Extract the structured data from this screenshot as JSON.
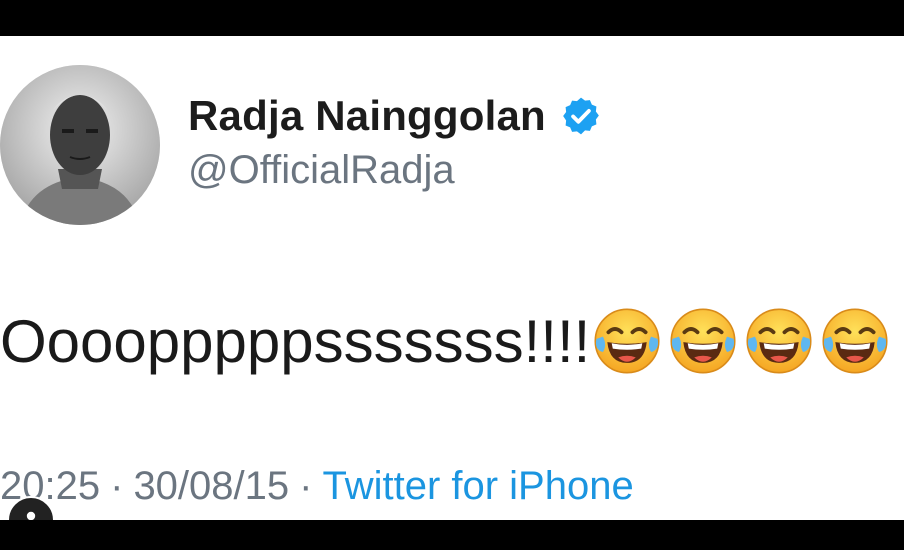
{
  "tweet": {
    "display_name": "Radja Nainggolan",
    "handle": "@OfficialRadja",
    "text": "Oooopppppsssssss!!!!",
    "emoji_count": 4,
    "emoji_icon": "face-with-tears-of-joy-icon",
    "time": "20:25",
    "date": "30/08/15",
    "source": "Twitter for iPhone",
    "separator": "·"
  },
  "colors": {
    "verified": "#1da1f2",
    "link": "#1b95e0",
    "secondary_text": "#6b7580"
  }
}
